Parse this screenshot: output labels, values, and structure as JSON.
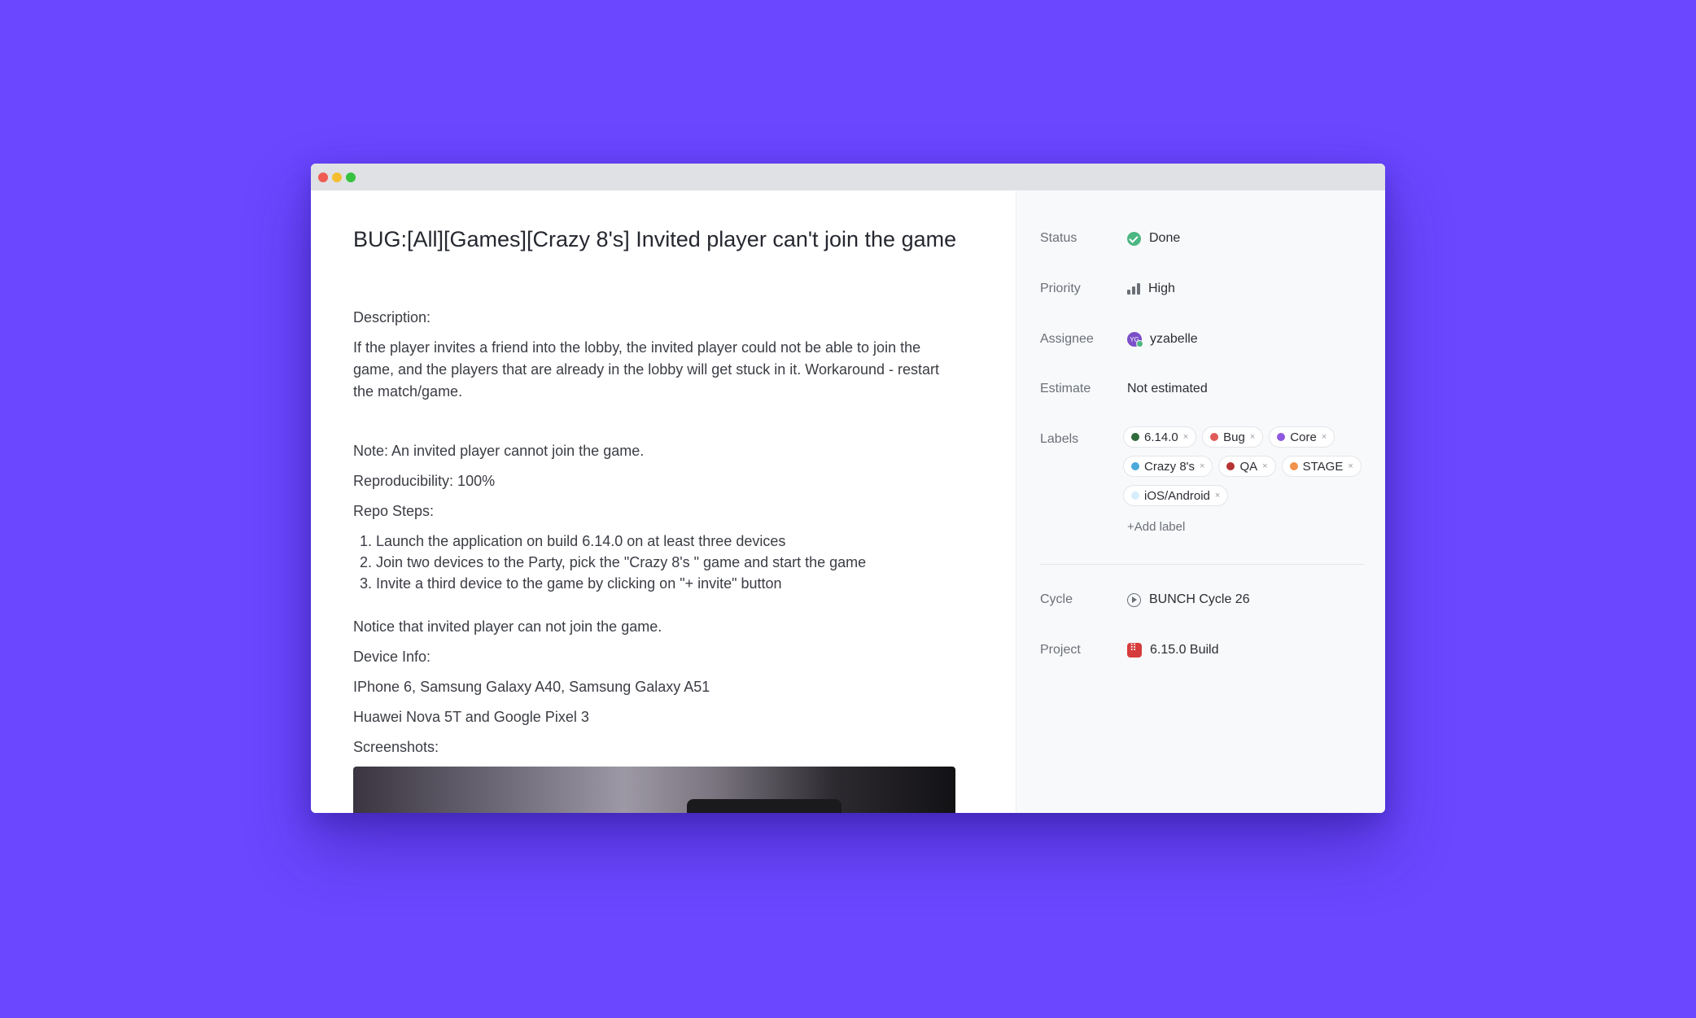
{
  "issue": {
    "title": "BUG:[All][Games][Crazy 8's] Invited player can't join the game",
    "description_label": "Description:",
    "description": "If the player invites a friend into the lobby, the invited player could not be able to join the game, and the players that are already in the lobby will get stuck in it. Workaround - restart the match/game.",
    "note": "Note: An invited player cannot join the game.",
    "reproducibility": "Reproducibility: 100%",
    "repo_steps_label": "Repo Steps:",
    "steps": [
      "Launch the application on build 6.14.0 on at least three devices",
      "Join two devices to the Party, pick the \"Crazy 8's \" game and start the game",
      "Invite a third device to the game by clicking on \"+ invite\" button"
    ],
    "notice": "Notice that invited player can not join the game.",
    "device_info_label": "Device Info:",
    "devices_line1": "IPhone 6, Samsung Galaxy A40, Samsung Galaxy A51",
    "devices_line2": "Huawei Nova 5T and Google Pixel 3",
    "screenshots_label": "Screenshots:"
  },
  "properties": {
    "status_label": "Status",
    "status_value": "Done",
    "priority_label": "Priority",
    "priority_value": "High",
    "assignee_label": "Assignee",
    "assignee_value": "yzabelle",
    "assignee_initials": "YG",
    "estimate_label": "Estimate",
    "estimate_value": "Not estimated",
    "labels_label": "Labels",
    "labels": [
      {
        "name": "6.14.0",
        "color": "#2f6b3b"
      },
      {
        "name": "Bug",
        "color": "#e05a5a"
      },
      {
        "name": "Core",
        "color": "#8e58e0"
      },
      {
        "name": "Crazy 8's",
        "color": "#4aa9d9"
      },
      {
        "name": "QA",
        "color": "#b73232"
      },
      {
        "name": "STAGE",
        "color": "#f0924a"
      },
      {
        "name": "iOS/Android",
        "color": "#d6eefc"
      }
    ],
    "label_remove_icon": "×",
    "add_label": "+Add label",
    "cycle_label": "Cycle",
    "cycle_value": "BUNCH Cycle 26",
    "project_label": "Project",
    "project_value": "6.15.0 Build"
  },
  "icons": {
    "status": "check-circle-icon",
    "priority": "signal-bars-icon",
    "cycle": "play-circle-icon",
    "project": "project-grid-icon"
  }
}
